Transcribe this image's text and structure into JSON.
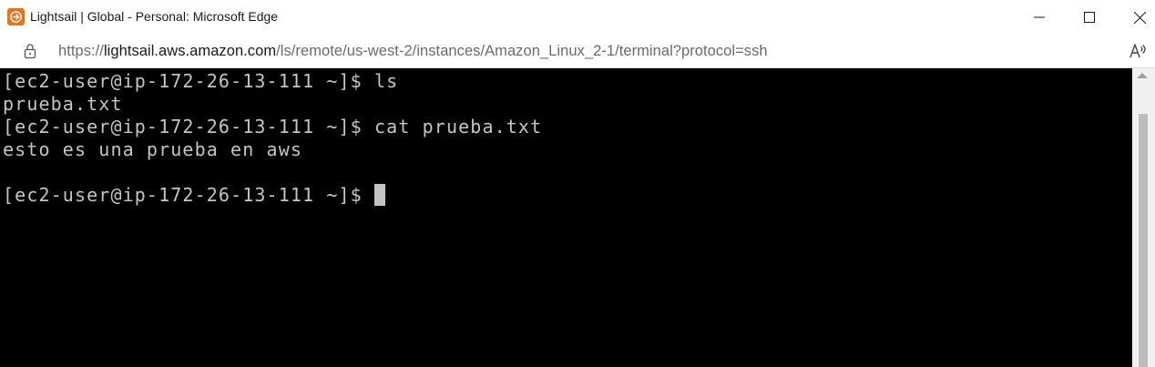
{
  "window": {
    "title": "Lightsail | Global - Personal: Microsoft Edge"
  },
  "addressbar": {
    "url_prefix": "https://",
    "url_domain": "lightsail.aws.amazon.com",
    "url_path": "/ls/remote/us-west-2/instances/Amazon_Linux_2-1/terminal?protocol=ssh"
  },
  "terminal": {
    "lines": [
      "[ec2-user@ip-172-26-13-111 ~]$ ls",
      "prueba.txt",
      "[ec2-user@ip-172-26-13-111 ~]$ cat prueba.txt",
      "esto es una prueba en aws",
      "",
      "[ec2-user@ip-172-26-13-111 ~]$ "
    ]
  },
  "icons": {
    "app": "lightsail-icon",
    "lock": "lock-icon",
    "read_aloud": "read-aloud-icon",
    "minimize": "minimize-icon",
    "maximize": "maximize-icon",
    "close": "close-icon"
  },
  "colors": {
    "app_icon": "#e8731f",
    "terminal_bg": "#000000",
    "terminal_fg": "#c4c4c4"
  }
}
